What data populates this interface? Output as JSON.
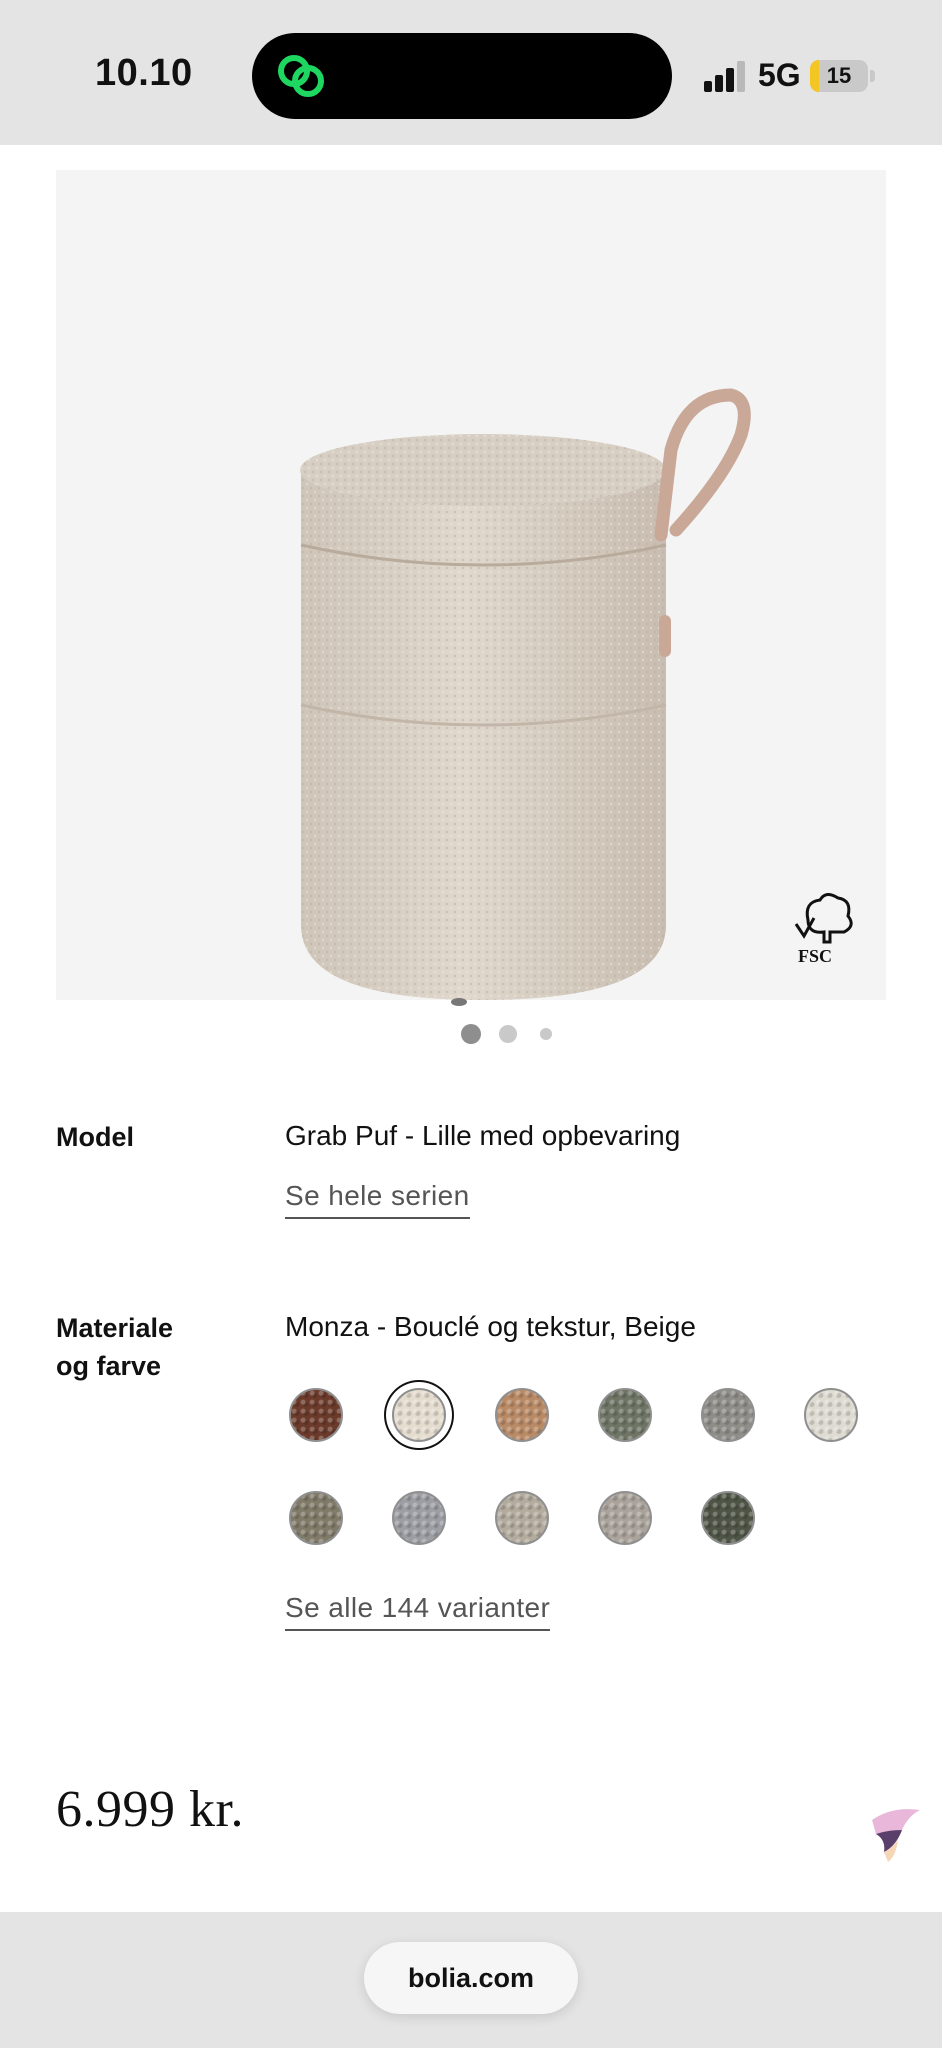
{
  "status_bar": {
    "time": "10.10",
    "network": "5G",
    "battery": "15",
    "battery_level": 0.15
  },
  "product": {
    "image_alt": "Grab Puf - Lille med opbevaring, beige bouclé",
    "certification": "FSC",
    "carousel": {
      "count": 3,
      "active": 0
    }
  },
  "model": {
    "label": "Model",
    "value": "Grab Puf - Lille med opbevaring",
    "series_link": "Se hele serien"
  },
  "material": {
    "label_line1": "Materiale",
    "label_line2": "og farve",
    "value": "Monza - Bouclé og tekstur, Beige",
    "selected_index": 1,
    "swatches": [
      {
        "color": "#6b3a2b"
      },
      {
        "color": "#e4dccf"
      },
      {
        "color": "#b98a66"
      },
      {
        "color": "#6e7565"
      },
      {
        "color": "#8f8d88"
      },
      {
        "color": "#dedbd2"
      },
      {
        "color": "#807a68"
      },
      {
        "color": "#9c9ea4"
      },
      {
        "color": "#b3ab9d"
      },
      {
        "color": "#aaa39b"
      },
      {
        "color": "#4f5546"
      }
    ],
    "variants_link": "Se alle 144 varianter"
  },
  "price": "6.999 kr.",
  "browser": {
    "url": "bolia.com"
  },
  "colors": {
    "status_bg": "#e4e4e4",
    "image_bg": "#f4f4f4",
    "island_icon": "#1ed760",
    "battery_fill": "#f3c623"
  }
}
